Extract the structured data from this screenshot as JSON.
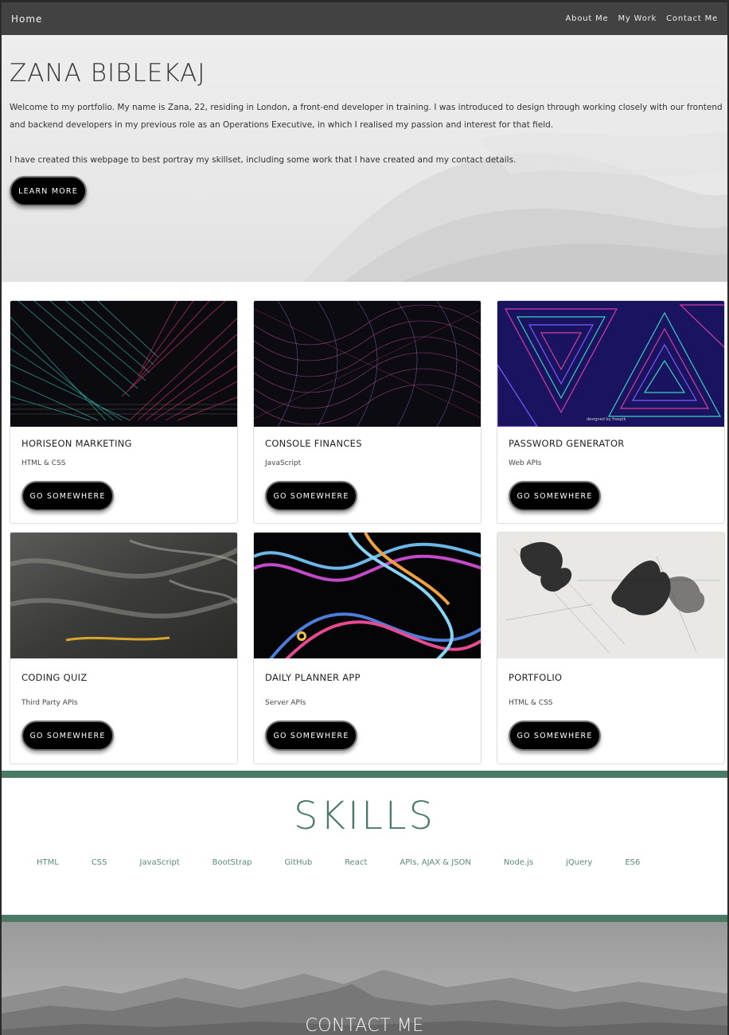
{
  "nav": {
    "home": "Home",
    "links": [
      "About Me",
      "My Work",
      "Contact Me"
    ]
  },
  "hero": {
    "title": "ZANA BIBLEKAJ",
    "paragraph1": "Welcome to my portfolio. My name is Zana, 22, residing in London, a front-end developer in training. I was introduced to design through working closely with our frontend and backend developers in my previous role as an Operations Executive, in which I realised my passion and interest for that field.",
    "paragraph2": "I have created this webpage to best portray my skillset, including some work that I have created and my contact details.",
    "button": "LEARN MORE"
  },
  "projects": [
    {
      "title": "HORISEON MARKETING",
      "tech": "HTML & CSS",
      "button": "GO SOMEWHERE"
    },
    {
      "title": "CONSOLE FINANCES",
      "tech": "JavaScript",
      "button": "GO SOMEWHERE"
    },
    {
      "title": "PASSWORD GENERATOR",
      "tech": "Web APIs",
      "button": "GO SOMEWHERE"
    },
    {
      "title": "CODING QUIZ",
      "tech": "Third Party APIs",
      "button": "GO SOMEWHERE"
    },
    {
      "title": "DAILY PLANNER APP",
      "tech": "Server APIs",
      "button": "GO SOMEWHERE"
    },
    {
      "title": "PORTFOLIO",
      "tech": "HTML & CSS",
      "button": "GO SOMEWHERE"
    }
  ],
  "skills": {
    "title": "SKILLS",
    "items": [
      "HTML",
      "CSS",
      "JavaScript",
      "BootStrap",
      "GitHub",
      "React",
      "APIs, AJAX & JSON",
      "Node.js",
      "jQuery",
      "ES6"
    ]
  },
  "contact": {
    "title": "CONTACT ME"
  },
  "colors": {
    "nav_bg": "#424242",
    "accent_green": "#4a7a63",
    "button_bg": "#000000"
  }
}
